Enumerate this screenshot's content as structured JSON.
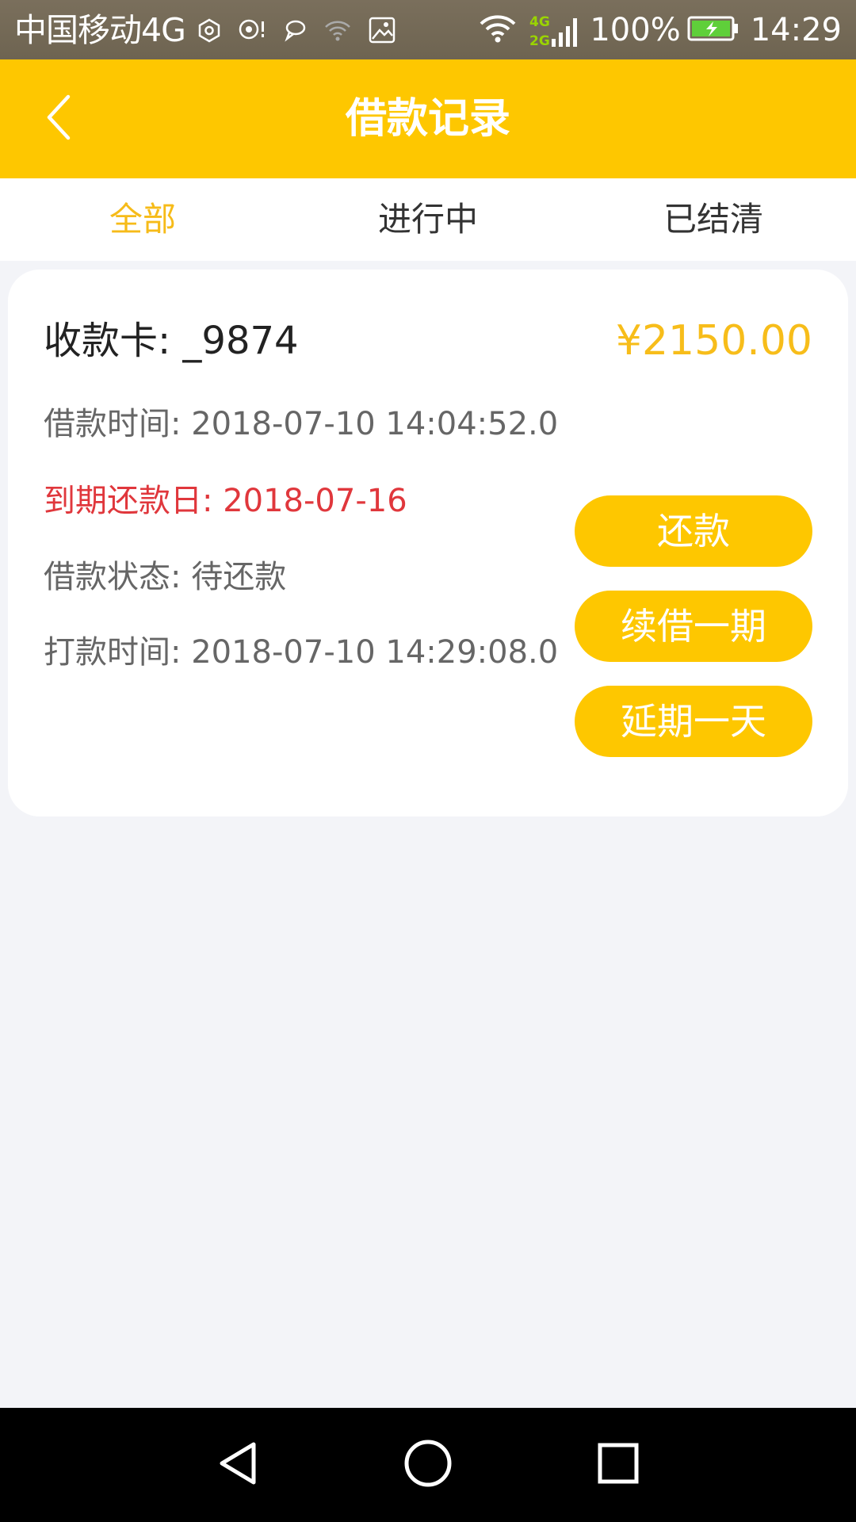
{
  "status_bar": {
    "carrier": "中国移动4G",
    "network_badge_top": "4G",
    "network_badge_bottom": "2G",
    "battery": "100%",
    "time": "14:29",
    "icons_left": [
      "hexagon-icon",
      "broadcast-icon",
      "chat-bubble-icon",
      "wifi-question-icon",
      "image-icon"
    ],
    "icons_right": [
      "wifi-icon",
      "signal-icon",
      "battery-charging-icon"
    ]
  },
  "header": {
    "title": "借款记录",
    "back_icon": "chevron-left-icon"
  },
  "tabs": [
    {
      "label": "全部",
      "active": true
    },
    {
      "label": "进行中",
      "active": false
    },
    {
      "label": "已结清",
      "active": false
    }
  ],
  "loan_record": {
    "card": "收款卡: _9874",
    "amount": "¥2150.00",
    "loan_time": "借款时间: 2018-07-10 14:04:52.0",
    "due_date": "到期还款日: 2018-07-16",
    "status": "借款状态: 待还款",
    "payout_time": "打款时间: 2018-07-10 14:29:08.0",
    "buttons": {
      "repay": "还款",
      "renew": "续借一期",
      "extend": "延期一天"
    }
  },
  "nav_bar": {
    "icons": [
      "back-triangle-icon",
      "home-circle-icon",
      "recents-square-icon"
    ]
  },
  "colors": {
    "accent": "#fec700",
    "accent_text": "#f6bb19",
    "due_red": "#e0373c",
    "page_bg": "#f3f4f8"
  }
}
